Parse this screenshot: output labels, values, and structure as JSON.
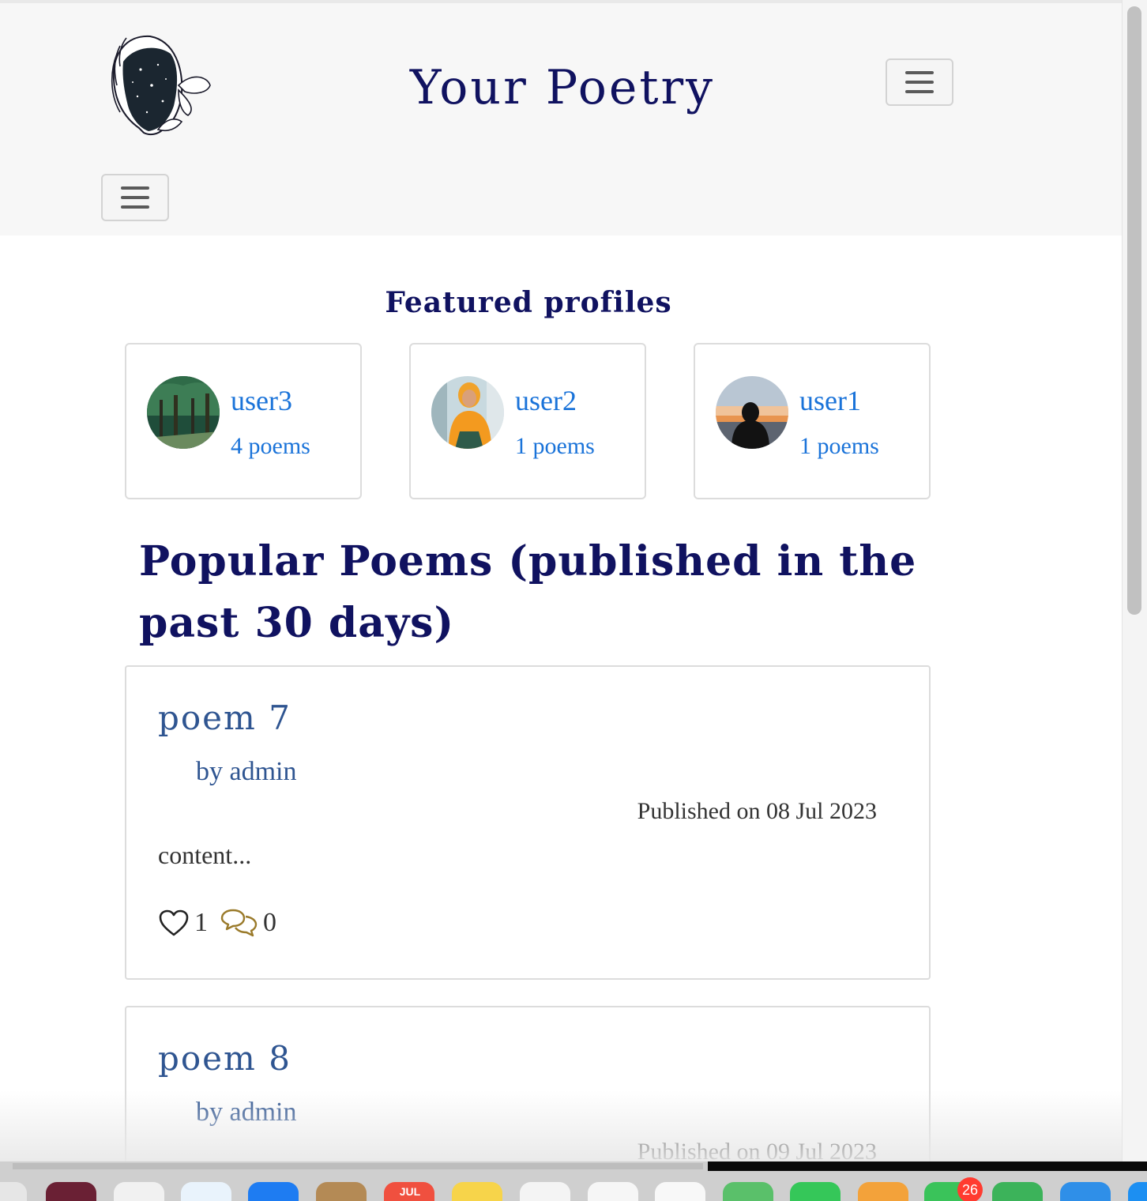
{
  "header": {
    "site_title": "Your Poetry",
    "logo_icon": "poet-face-logo",
    "menu_icon": "hamburger-icon"
  },
  "featured": {
    "title": "Featured profiles",
    "profiles": [
      {
        "name": "user3",
        "count": "4 poems",
        "avatar": "forest-avatar"
      },
      {
        "name": "user2",
        "count": "1 poems",
        "avatar": "girl-orange-hoodie-avatar"
      },
      {
        "name": "user1",
        "count": "1 poems",
        "avatar": "sunset-silhouette-avatar"
      }
    ]
  },
  "popular": {
    "title": "Popular Poems (published in the past 30 days)",
    "poems": [
      {
        "title": "poem 7",
        "author": "by admin",
        "date": "Published on 08 Jul 2023",
        "content": "content...",
        "likes": "1",
        "comments": "0"
      },
      {
        "title": "poem 8",
        "author": "by admin",
        "date": "Published on 09 Jul 2023"
      }
    ]
  },
  "dock": {
    "calendar_label": "JUL",
    "messages_badge": "26"
  },
  "colors": {
    "title_navy": "#101260",
    "link_blue": "#1a73d9",
    "poem_blue": "#2f5591",
    "comment_gold": "#9a7a2a"
  }
}
